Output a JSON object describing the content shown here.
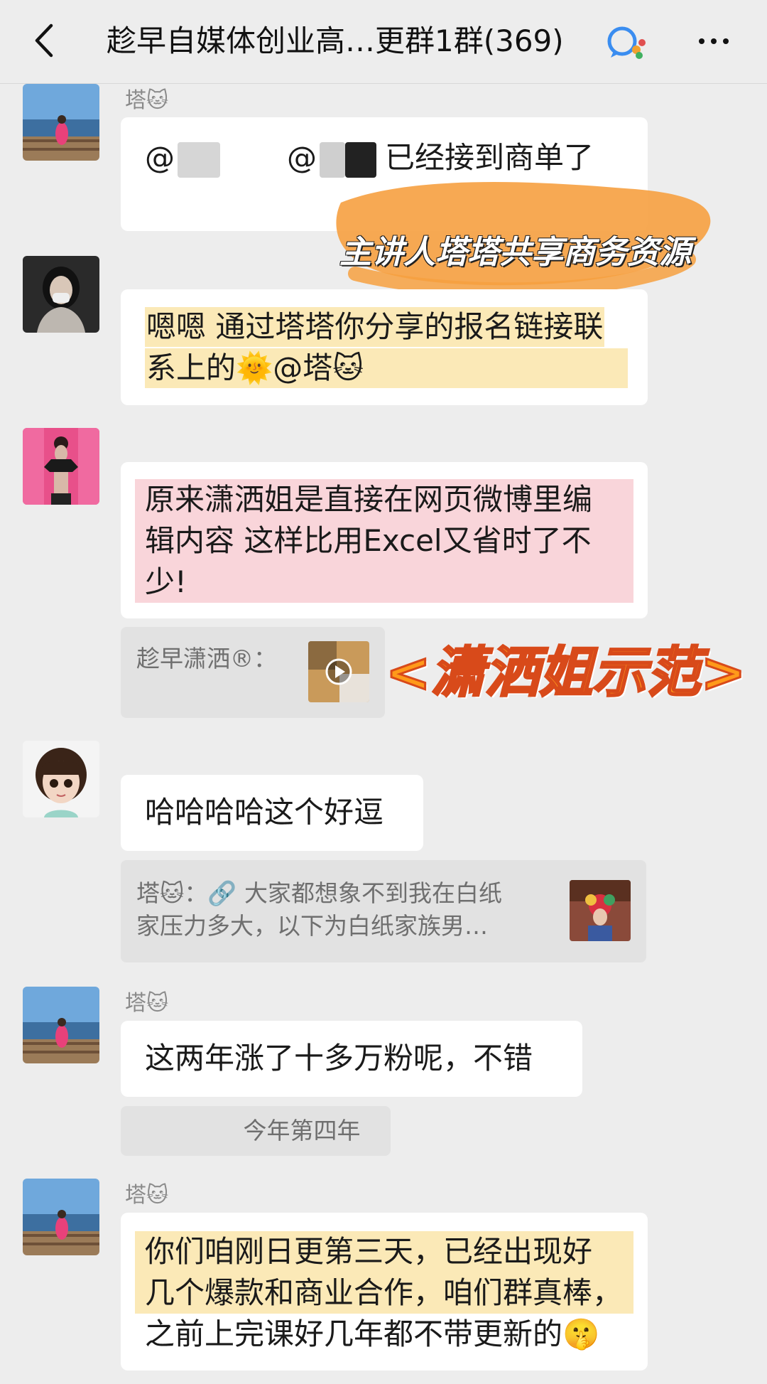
{
  "header": {
    "title": "趁早自媒体创业高…更群1群(369)"
  },
  "messages": {
    "m1": {
      "sender": "塔🐱",
      "at1": "@",
      "at2": "@",
      "text": "已经接到商单了"
    },
    "overlay1": "主讲人塔塔共享商务资源",
    "m2": {
      "text_line1": "嗯嗯 通过塔塔你分享的报名链接联",
      "text_line2": "系上的🌞@塔🐱"
    },
    "m3": {
      "text_line1": "原来潇洒姐是直接在网页微博里编",
      "text_line2": "辑内容 这样比用Excel又省时了不",
      "text_line3": "少!",
      "quote_sender": "趁早潇洒®："
    },
    "overlay2": "<潇洒姐示范>",
    "m4": {
      "text": "哈哈哈哈这个好逗",
      "quote_line1": "塔🐱：🔗 大家都想象不到我在白纸",
      "quote_line2": "家压力多大，以下为白纸家族男…"
    },
    "m5": {
      "sender": "塔🐱",
      "text": "这两年涨了十多万粉呢，不错",
      "quote": "今年第四年"
    },
    "m6": {
      "sender": "塔🐱",
      "text_line1": "你们咱刚日更第三天，已经出现好",
      "text_line2": "几个爆款和商业合作，咱们群真棒，",
      "text_line3": "之前上完课好几年都不带更新的🤫"
    }
  },
  "colors": {
    "background": "#ededed",
    "bubble": "#ffffff",
    "highlight_yellow": "#fbe9b7",
    "highlight_pink": "#f9d5da",
    "overlay_orange": "#f6a040"
  }
}
